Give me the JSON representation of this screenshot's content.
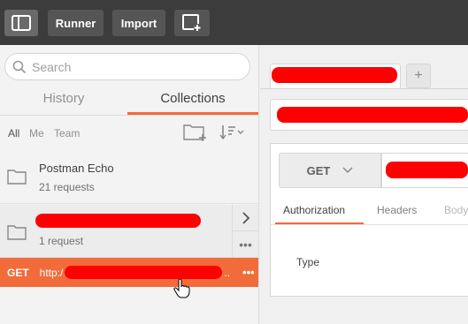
{
  "toolbar": {
    "runner_label": "Runner",
    "import_label": "Import"
  },
  "sidebar": {
    "search_placeholder": "Search",
    "tabs": [
      {
        "label": "History"
      },
      {
        "label": "Collections"
      }
    ],
    "filters": [
      {
        "label": "All"
      },
      {
        "label": "Me"
      },
      {
        "label": "Team"
      }
    ],
    "collections": [
      {
        "name": "Postman Echo",
        "count": "21 requests"
      },
      {
        "name": "",
        "count": "1 request"
      }
    ],
    "request": {
      "method": "GET",
      "url_prefix": "http:/",
      "url_suffix": ".."
    },
    "more_label": "•••"
  },
  "main": {
    "method": "GET",
    "sub_tabs": [
      {
        "label": "Authorization"
      },
      {
        "label": "Headers"
      },
      {
        "label": "Body"
      }
    ],
    "type_label": "Type",
    "plus_label": "+"
  },
  "colors": {
    "accent": "#f26b3a",
    "toolbar": "#3c3c3c",
    "redaction": "#ff0000"
  }
}
